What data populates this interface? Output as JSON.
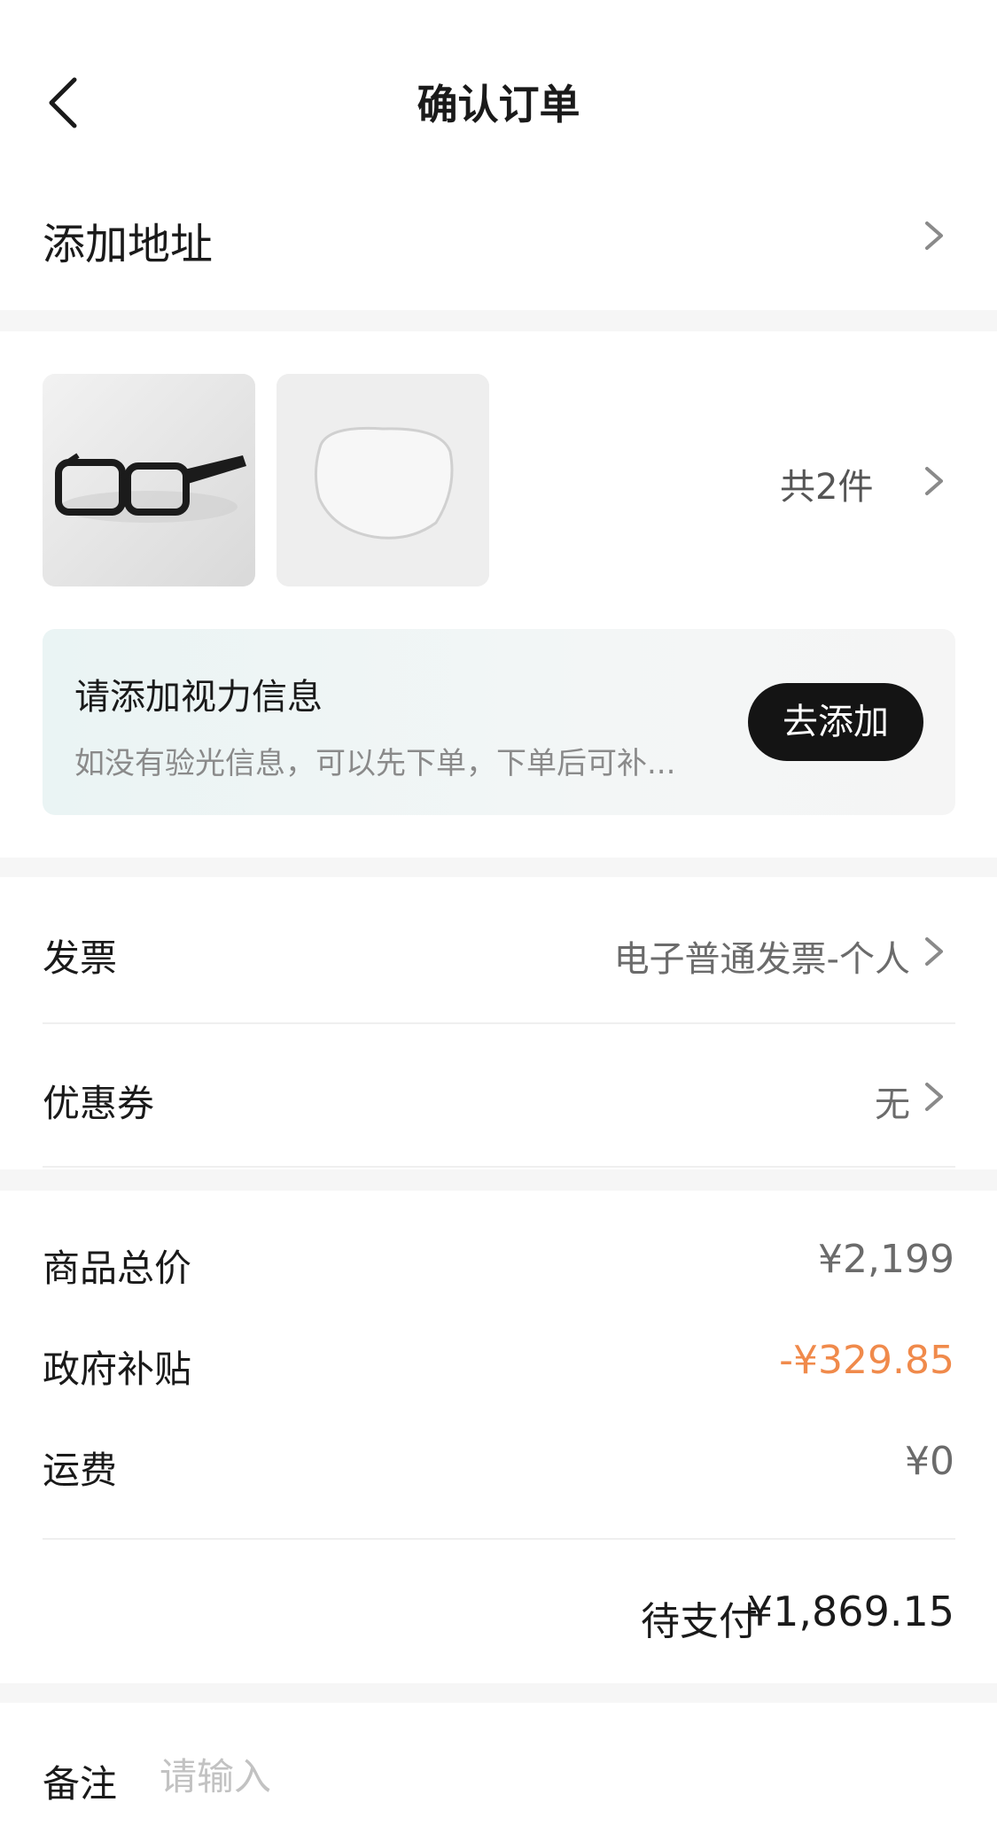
{
  "header": {
    "title": "确认订单"
  },
  "address": {
    "label": "添加地址"
  },
  "products": {
    "items": [
      {
        "name": "smart-glasses",
        "icon": "glasses-image"
      },
      {
        "name": "lens",
        "icon": "lens-image"
      }
    ],
    "count_label": "共2件"
  },
  "vision": {
    "title": "请添加视力信息",
    "description": "如没有验光信息，可以先下单，下单后可补...",
    "button": "去添加"
  },
  "invoice": {
    "label": "发票",
    "value": "电子普通发票-个人"
  },
  "coupon": {
    "label": "优惠券",
    "value": "无"
  },
  "prices": {
    "goods_label": "商品总价",
    "goods_value": "¥2,199",
    "subsidy_label": "政府补贴",
    "subsidy_value": "-¥329.85",
    "shipping_label": "运费",
    "shipping_value": "¥0",
    "total_label": "待支付",
    "total_value": "¥1,869.15"
  },
  "note": {
    "label": "备注",
    "placeholder": "请输入"
  },
  "colors": {
    "accent_orange": "#f08a4b",
    "button_dark": "#141414",
    "background_gap": "#f6f6f6"
  }
}
